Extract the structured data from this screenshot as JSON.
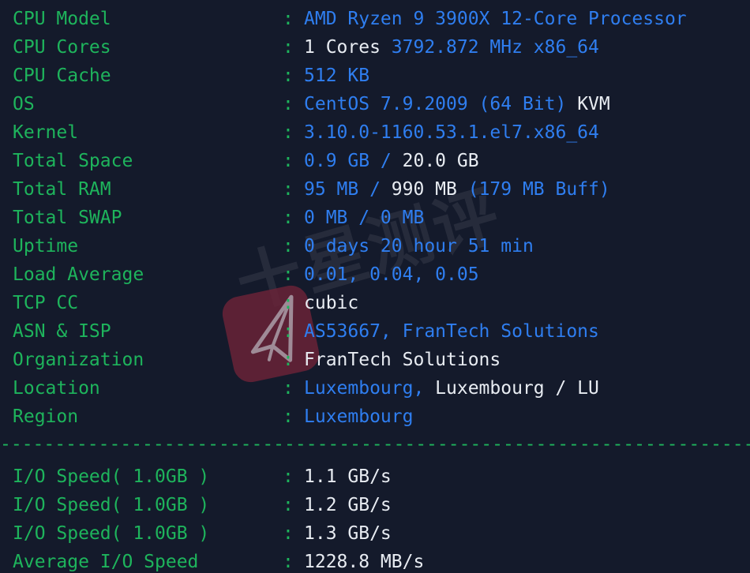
{
  "terminal": {
    "background": "#141a2b",
    "label_color": "#1eb45c",
    "value_color": "#2f7ef0",
    "plain_color": "#e8ecf2",
    "separator": "----------------------------------------------------------------------"
  },
  "watermark": {
    "text": "十星测评",
    "logo_color": "#6d2338",
    "icon": "paper-plane-icon"
  },
  "system_info": [
    {
      "label": "CPU Model",
      "colon": ":",
      "parts": [
        {
          "t": "AMD Ryzen 9 3900X 12-Core Processor",
          "c": "val"
        }
      ]
    },
    {
      "label": "CPU Cores",
      "colon": ":",
      "parts": [
        {
          "t": "1 Cores ",
          "c": "w"
        },
        {
          "t": "3792.872 MHz x86_64",
          "c": "val"
        }
      ]
    },
    {
      "label": "CPU Cache",
      "colon": ":",
      "parts": [
        {
          "t": "512 KB",
          "c": "val"
        }
      ]
    },
    {
      "label": "OS",
      "colon": ":",
      "parts": [
        {
          "t": "CentOS 7.9.2009 (64 Bit) ",
          "c": "val"
        },
        {
          "t": "KVM",
          "c": "w"
        }
      ]
    },
    {
      "label": "Kernel",
      "colon": ":",
      "parts": [
        {
          "t": "3.10.0-1160.53.1.el7.x86_64",
          "c": "val"
        }
      ]
    },
    {
      "label": "Total Space",
      "colon": ":",
      "parts": [
        {
          "t": "0.9 GB / ",
          "c": "val"
        },
        {
          "t": "20.0 GB",
          "c": "w"
        }
      ]
    },
    {
      "label": "Total RAM",
      "colon": ":",
      "parts": [
        {
          "t": "95 MB / ",
          "c": "val"
        },
        {
          "t": "990 MB ",
          "c": "w"
        },
        {
          "t": "(179 MB Buff)",
          "c": "val"
        }
      ]
    },
    {
      "label": "Total SWAP",
      "colon": ":",
      "parts": [
        {
          "t": "0 MB / 0 MB",
          "c": "val"
        }
      ]
    },
    {
      "label": "Uptime",
      "colon": ":",
      "parts": [
        {
          "t": "0 days 20 hour 51 min",
          "c": "val"
        }
      ]
    },
    {
      "label": "Load Average",
      "colon": ":",
      "parts": [
        {
          "t": "0.01, 0.04, 0.05",
          "c": "val"
        }
      ]
    },
    {
      "label": "TCP CC",
      "colon": ":",
      "parts": [
        {
          "t": "cubic",
          "c": "w"
        }
      ]
    },
    {
      "label": "ASN & ISP",
      "colon": ":",
      "parts": [
        {
          "t": "AS53667, FranTech Solutions",
          "c": "val"
        }
      ]
    },
    {
      "label": "Organization",
      "colon": ":",
      "parts": [
        {
          "t": "FranTech Solutions",
          "c": "w"
        }
      ]
    },
    {
      "label": "Location",
      "colon": ":",
      "parts": [
        {
          "t": "Luxembourg, ",
          "c": "val"
        },
        {
          "t": "Luxembourg / LU",
          "c": "w"
        }
      ]
    },
    {
      "label": "Region",
      "colon": ":",
      "parts": [
        {
          "t": "Luxembourg",
          "c": "val"
        }
      ]
    }
  ],
  "io_results": [
    {
      "label": "I/O Speed( 1.0GB )",
      "colon": ":",
      "parts": [
        {
          "t": "1.1 GB/s",
          "c": "w"
        }
      ]
    },
    {
      "label": "I/O Speed( 1.0GB )",
      "colon": ":",
      "parts": [
        {
          "t": "1.2 GB/s",
          "c": "w"
        }
      ]
    },
    {
      "label": "I/O Speed( 1.0GB )",
      "colon": ":",
      "parts": [
        {
          "t": "1.3 GB/s",
          "c": "w"
        }
      ]
    },
    {
      "label": "Average I/O Speed",
      "colon": ":",
      "parts": [
        {
          "t": "1228.8 MB/s",
          "c": "w"
        }
      ]
    }
  ]
}
